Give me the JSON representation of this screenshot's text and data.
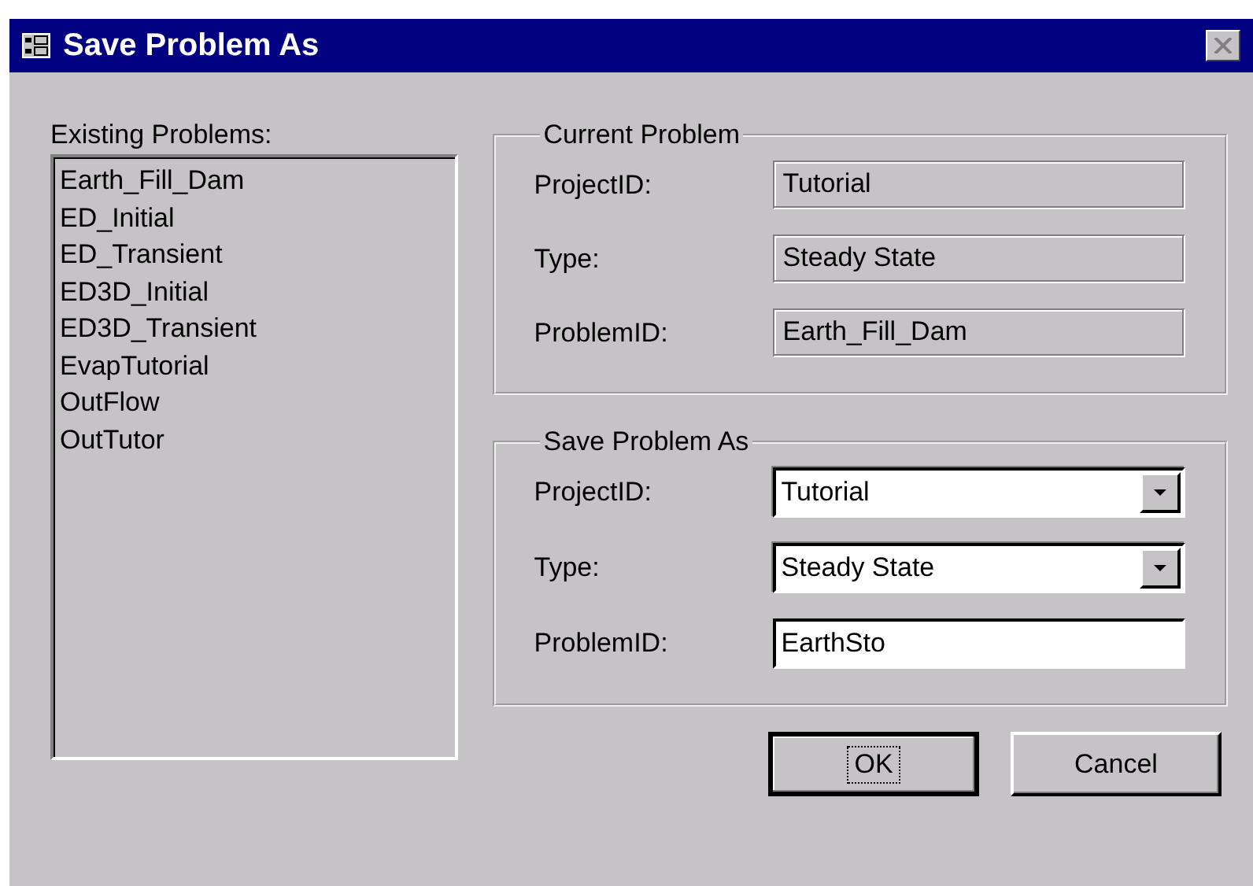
{
  "window": {
    "title": "Save Problem As"
  },
  "existing_problems": {
    "label": "Existing Problems:",
    "items": [
      "Earth_Fill_Dam",
      "ED_Initial",
      "ED_Transient",
      "ED3D_Initial",
      "ED3D_Transient",
      "EvapTutorial",
      "OutFlow",
      "OutTutor"
    ]
  },
  "current_problem": {
    "title": "Current Problem",
    "fields": [
      {
        "label": "ProjectID:",
        "value": "Tutorial"
      },
      {
        "label": "Type:",
        "value": "Steady State"
      },
      {
        "label": "ProblemID:",
        "value": "Earth_Fill_Dam"
      }
    ]
  },
  "save_problem_as": {
    "title": "Save Problem As",
    "fields": [
      {
        "kind": "combo",
        "label": "ProjectID:",
        "value": "Tutorial"
      },
      {
        "kind": "combo",
        "label": "Type:",
        "value": "Steady State"
      },
      {
        "kind": "text",
        "label": "ProblemID:",
        "value": "EarthSto"
      }
    ]
  },
  "buttons": [
    {
      "label": "OK",
      "default": true
    },
    {
      "label": "Cancel",
      "default": false
    }
  ]
}
